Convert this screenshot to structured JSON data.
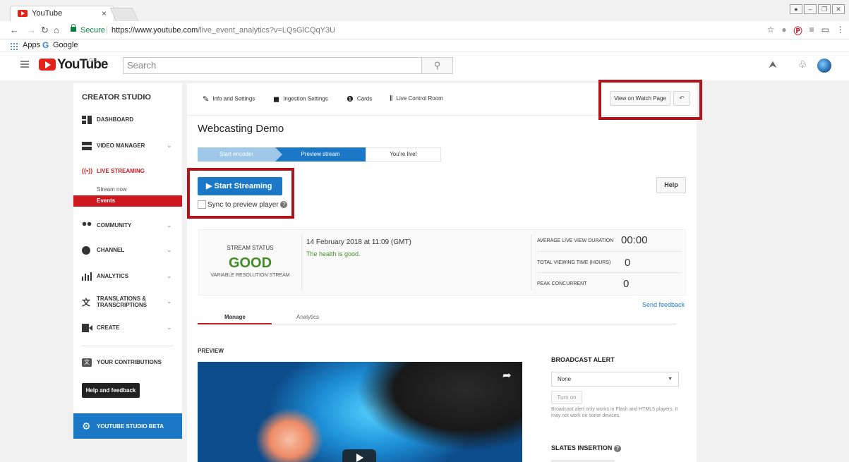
{
  "browser": {
    "tab_title": "YouTube",
    "tab_close": "×",
    "secure_label": "Secure",
    "url_domain": "https://www.youtube.com",
    "url_path": "/live_event_analytics?v=LQsGlCQqY3U",
    "bookmarks": [
      {
        "label": "Apps",
        "icon": "apps-grid-icon"
      },
      {
        "label": "Google",
        "icon": "google-g-icon"
      }
    ]
  },
  "masthead": {
    "logo_text": "YouTube",
    "region": "GB",
    "search_placeholder": "Search"
  },
  "sidebar": {
    "title": "CREATOR STUDIO",
    "items": [
      {
        "label": "DASHBOARD",
        "icon": "dashboard-icon"
      },
      {
        "label": "VIDEO MANAGER",
        "icon": "video-manager-icon"
      },
      {
        "label": "LIVE STREAMING",
        "icon": "live-streaming-icon"
      },
      {
        "label": "COMMUNITY",
        "icon": "community-icon"
      },
      {
        "label": "CHANNEL",
        "icon": "channel-icon"
      },
      {
        "label": "ANALYTICS",
        "icon": "analytics-icon"
      },
      {
        "label": "TRANSLATIONS & TRANSCRIPTIONS",
        "icon": "translate-icon"
      },
      {
        "label": "CREATE",
        "icon": "create-icon"
      }
    ],
    "live_sub": [
      "Stream now",
      "Events"
    ],
    "contributions_label": "YOUR CONTRIBUTIONS",
    "help_label": "Help and feedback",
    "studio_beta_label": "YOUTUBE STUDIO BETA"
  },
  "main": {
    "nav": [
      {
        "label": "Info and Settings",
        "icon": "pencil-icon"
      },
      {
        "label": "Ingestion Settings",
        "icon": "camera-icon"
      },
      {
        "label": "Cards",
        "icon": "info-icon"
      },
      {
        "label": "Live Control Room",
        "icon": "sliders-icon"
      }
    ],
    "view_watch_label": "View on Watch Page",
    "event_title": "Webcasting Demo",
    "steps": [
      "Start encoder",
      "Preview stream",
      "You're live!"
    ],
    "active_step": 1,
    "start_streaming_label": "Start Streaming",
    "sync_label": "Sync to preview player",
    "help_label": "Help",
    "status": {
      "label": "STREAM STATUS",
      "value": "GOOD",
      "sub": "VARIABLE RESOLUTION STREAM",
      "date": "14 February 2018 at 11:09 (GMT)",
      "health": "The health is good."
    },
    "metrics": [
      {
        "label": "AVERAGE LIVE VIEW DURATION",
        "value": "00:00"
      },
      {
        "label": "TOTAL VIEWING TIME (HOURS)",
        "value": "0"
      },
      {
        "label": "PEAK CONCURRENT",
        "value": "0"
      }
    ],
    "send_feedback": "Send feedback",
    "subtabs": [
      "Manage",
      "Analytics"
    ],
    "preview_label": "PREVIEW",
    "broadcast_alert": {
      "title": "BROADCAST ALERT",
      "selected": "None",
      "turn_on_label": "Turn on",
      "note": "Broadcast alert only works in Flash and HTML5 players. It may not work on some devices."
    },
    "slates_title": "SLATES INSERTION"
  },
  "colors": {
    "youtube_red": "#e62117",
    "studio_blue": "#1b78c6",
    "good_green": "#438c26",
    "highlight_red": "#b0141c"
  }
}
